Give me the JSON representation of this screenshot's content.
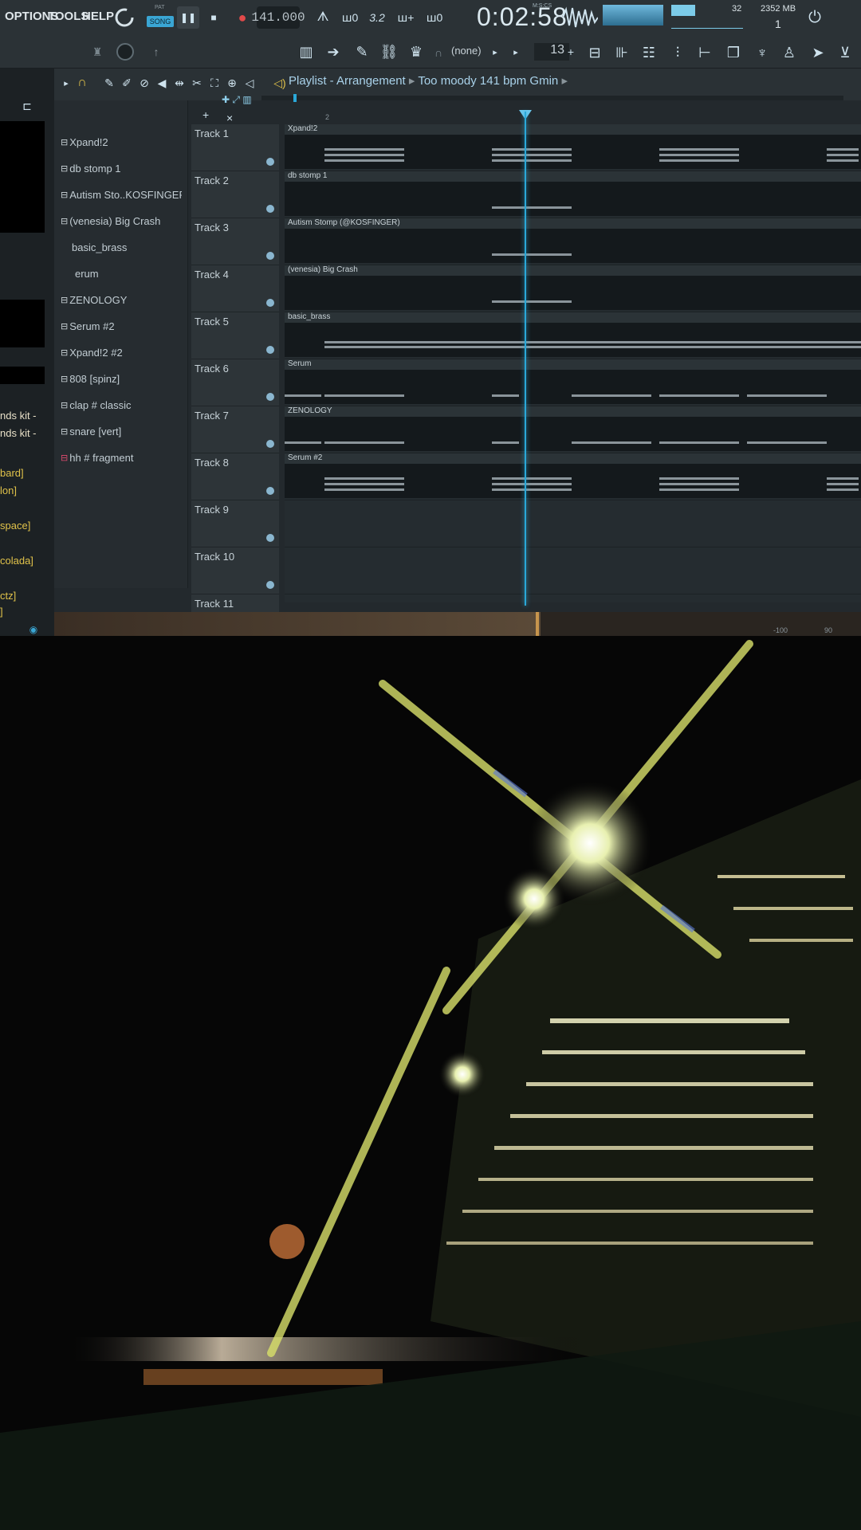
{
  "menu": {
    "options": "OPTIONS",
    "tools": "TOOLS",
    "help": "HELP"
  },
  "transport": {
    "pat_song_mode": "SONG",
    "pat_label": "PAT",
    "tempo": "141.000",
    "song_time": "0:02:58",
    "time_format": "M:S:CS"
  },
  "meters": {
    "cpu": "32",
    "memory": "2352 MB",
    "voices": "1"
  },
  "toolbar2": {
    "snap": "(none)",
    "step": "13"
  },
  "playlist": {
    "title": "Playlist - Arrangement",
    "pattern": "Too moody 141 bpm Gmin",
    "bar_marker": "2"
  },
  "channels": [
    {
      "name": "Xpand!2"
    },
    {
      "name": "db stomp 1"
    },
    {
      "name": "Autism Sto..KOSFINGER)"
    },
    {
      "name": "(venesia) Big Crash"
    },
    {
      "name": "basic_brass"
    },
    {
      "name": "erum"
    },
    {
      "name": "ZENOLOGY"
    },
    {
      "name": "Serum #2"
    },
    {
      "name": "Xpand!2 #2"
    },
    {
      "name": "808 [spinz]"
    },
    {
      "name": "clap # classic"
    },
    {
      "name": "snare [vert]"
    },
    {
      "name": "hh # fragment"
    }
  ],
  "tracks": [
    "Track 1",
    "Track 2",
    "Track 3",
    "Track 4",
    "Track 5",
    "Track 6",
    "Track 7",
    "Track 8",
    "Track 9",
    "Track 10",
    "Track 11"
  ],
  "clips": [
    {
      "label": "Xpand!2"
    },
    {
      "label": "db stomp 1"
    },
    {
      "label": "Autism Stomp (@KOSFINGER)"
    },
    {
      "label": "(venesia) Big Crash"
    },
    {
      "label": "basic_brass"
    },
    {
      "label": "Serum"
    },
    {
      "label": "ZENOLOGY"
    },
    {
      "label": "Serum #2"
    }
  ],
  "browser_snippets": [
    "nds kit -",
    "nds kit -",
    "bard]",
    "lon]",
    "space]",
    "colada]",
    "ctz]",
    "]"
  ],
  "bottom": {
    "left_val": "-100",
    "right_val": "90"
  },
  "colors": {
    "accent": "#2aa8d8",
    "bg": "#23292d",
    "clip_bg": "#14191c",
    "note": "#8a949a",
    "photo_glow": "#d8e06a"
  }
}
